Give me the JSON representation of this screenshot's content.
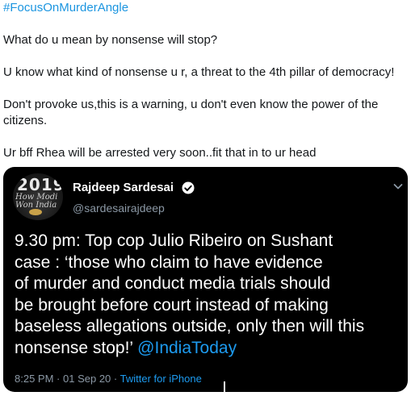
{
  "reply": {
    "hashtag": "#FocusOnMurderAngle",
    "paragraphs": [
      "What do u mean by nonsense will stop?",
      "U know what kind of nonsense u r, a threat to the 4th pillar of democracy!",
      "Don't provoke us,this is a warning, u don't even know the power of the",
      "citizens.",
      "Ur bff Rhea will be arrested very soon..fit that in to ur head"
    ]
  },
  "quoted": {
    "avatar": {
      "year": "2019",
      "subtitle": "How Modi Won India"
    },
    "display_name": "Rajdeep Sardesai",
    "handle": "@sardesairajdeep",
    "lines": [
      "9.30 pm: Top cop Julio Ribeiro on Sushant",
      "case : ‘those who claim to have evidence",
      "of murder and conduct media trials should",
      "be brought before court instead of making",
      "baseless allegations outside, only then will this",
      "nonsense stop!’"
    ],
    "mention": "@IndiaToday",
    "time": "8:25 PM",
    "date": "01 Sep 20",
    "separator": "·",
    "source": "Twitter for iPhone"
  },
  "colors": {
    "link": "#1b95e0",
    "card_background": "#000000",
    "mention": "#1d9bf0",
    "muted": "#8b98a5"
  }
}
